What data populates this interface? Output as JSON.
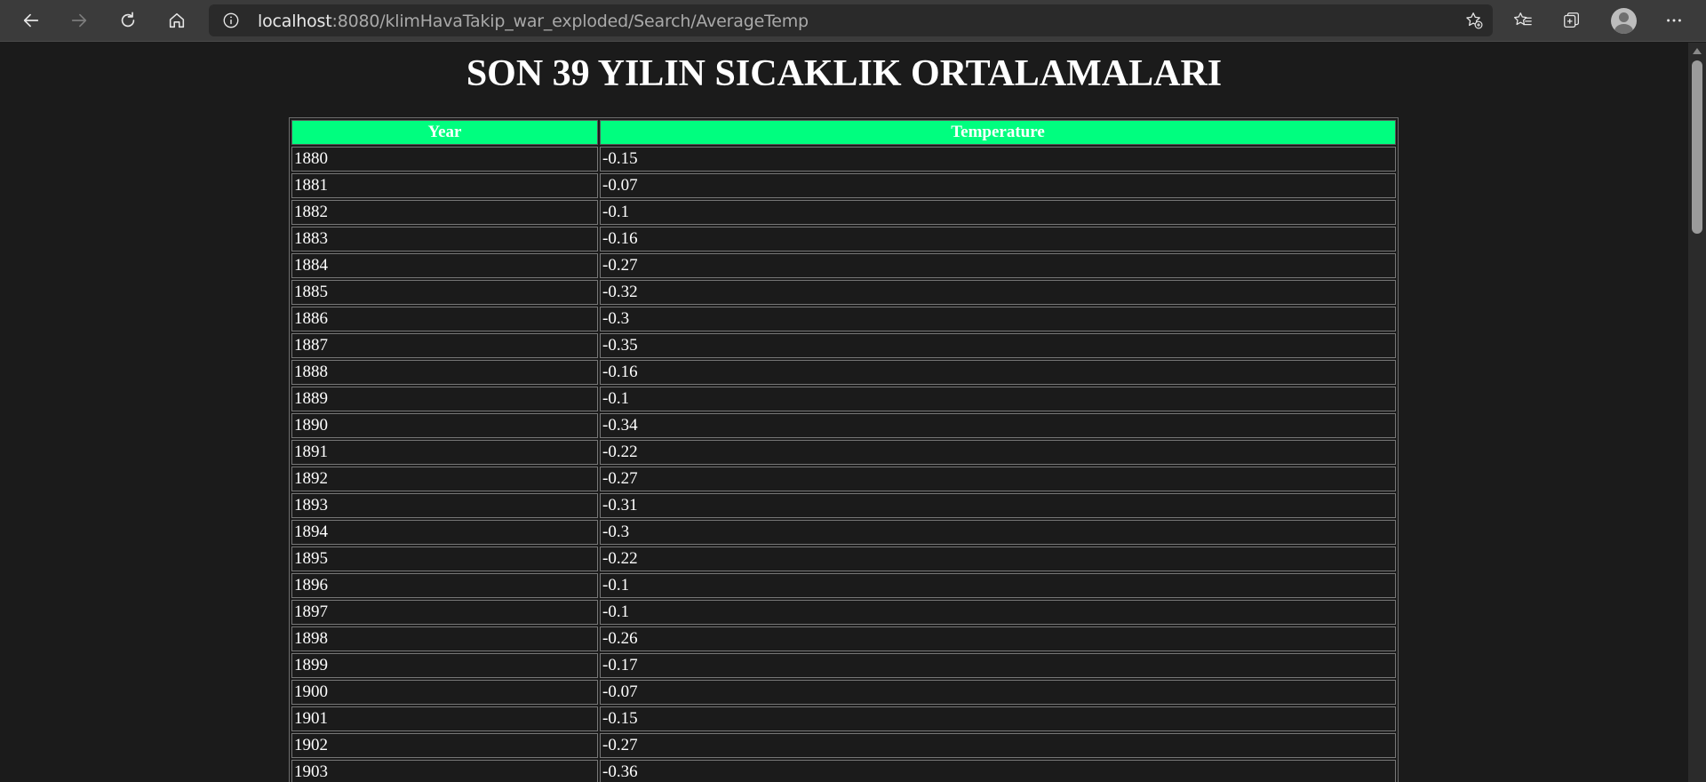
{
  "browser": {
    "url_host": "localhost",
    "url_rest": ":8080/klimHavaTakip_war_exploded/Search/AverageTemp",
    "icons": {
      "back": "back-arrow-icon",
      "forward": "forward-arrow-icon",
      "refresh": "refresh-icon",
      "home": "home-icon",
      "info": "info-icon",
      "favorite_add": "star-add-icon",
      "favorites": "favorites-list-icon",
      "collections": "collections-icon",
      "profile": "avatar",
      "menu": "more-icon"
    }
  },
  "page": {
    "title": "SON 39 YILIN SICAKLIK ORTALAMALARI",
    "table": {
      "headers": [
        "Year",
        "Temperature"
      ],
      "header_color": "#00fe7f",
      "rows": [
        [
          "1880",
          "-0.15"
        ],
        [
          "1881",
          "-0.07"
        ],
        [
          "1882",
          "-0.1"
        ],
        [
          "1883",
          "-0.16"
        ],
        [
          "1884",
          "-0.27"
        ],
        [
          "1885",
          "-0.32"
        ],
        [
          "1886",
          "-0.3"
        ],
        [
          "1887",
          "-0.35"
        ],
        [
          "1888",
          "-0.16"
        ],
        [
          "1889",
          "-0.1"
        ],
        [
          "1890",
          "-0.34"
        ],
        [
          "1891",
          "-0.22"
        ],
        [
          "1892",
          "-0.27"
        ],
        [
          "1893",
          "-0.31"
        ],
        [
          "1894",
          "-0.3"
        ],
        [
          "1895",
          "-0.22"
        ],
        [
          "1896",
          "-0.1"
        ],
        [
          "1897",
          "-0.1"
        ],
        [
          "1898",
          "-0.26"
        ],
        [
          "1899",
          "-0.17"
        ],
        [
          "1900",
          "-0.07"
        ],
        [
          "1901",
          "-0.15"
        ],
        [
          "1902",
          "-0.27"
        ],
        [
          "1903",
          "-0.36"
        ]
      ]
    }
  }
}
